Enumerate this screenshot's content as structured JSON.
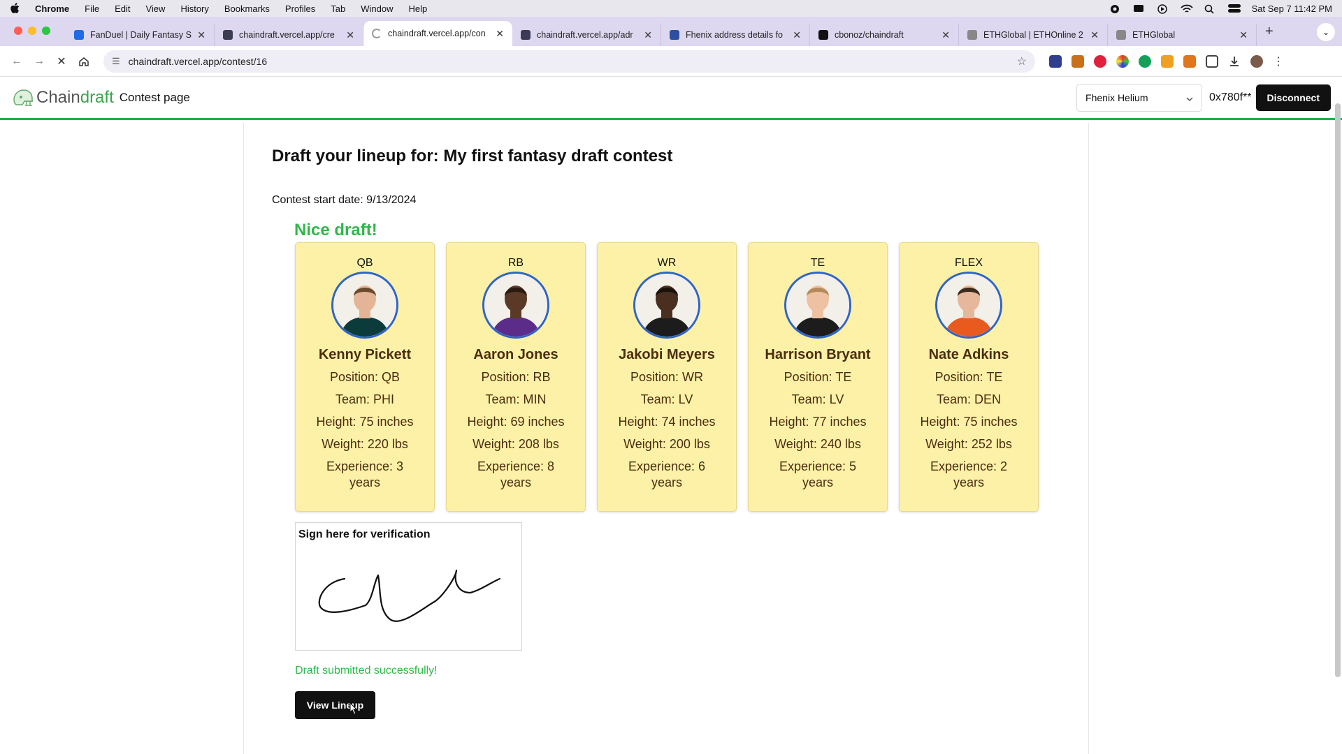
{
  "menubar": {
    "app": "Chrome",
    "items": [
      "File",
      "Edit",
      "View",
      "History",
      "Bookmarks",
      "Profiles",
      "Tab",
      "Window",
      "Help"
    ],
    "clock": "Sat Sep 7  11:42 PM"
  },
  "tabs": [
    {
      "title": "FanDuel | Daily Fantasy S",
      "color": "#1e6be8"
    },
    {
      "title": "chaindraft.vercel.app/cre",
      "color": "#3b3b54"
    },
    {
      "title": "chaindraft.vercel.app/con",
      "color": "#9a9a9a"
    },
    {
      "title": "chaindraft.vercel.app/adr",
      "color": "#3b3b54"
    },
    {
      "title": "Fhenix address details fo",
      "color": "#2d4fa0"
    },
    {
      "title": "cbonoz/chaindraft",
      "color": "#111111"
    },
    {
      "title": "ETHGlobal | ETHOnline 2",
      "color": "#888888"
    },
    {
      "title": "ETHGlobal",
      "color": "#888888"
    }
  ],
  "active_tab_index": 2,
  "omnibox": {
    "url": "chaindraft.vercel.app/contest/16"
  },
  "app": {
    "logo_chain": "Chain",
    "logo_draft": "draft",
    "page_label": "Contest page",
    "network": "Fhenix Helium",
    "address": "0x780f**",
    "disconnect_label": "Disconnect"
  },
  "contest": {
    "heading": "Draft your lineup for: My first fantasy draft contest",
    "start_date": "Contest start date: 9/13/2024",
    "nice_draft": "Nice draft!",
    "players": [
      {
        "slot": "QB",
        "name": "Kenny Pickett",
        "position": "Position: QB",
        "team": "Team: PHI",
        "height": "Height: 75 inches",
        "weight": "Weight: 220 lbs",
        "experience": "Experience: 3 years",
        "jersey": "#0c3b3b",
        "skin": "#e3b596",
        "hair": "#6b4a2e"
      },
      {
        "slot": "RB",
        "name": "Aaron Jones",
        "position": "Position: RB",
        "team": "Team: MIN",
        "height": "Height: 69 inches",
        "weight": "Weight: 208 lbs",
        "experience": "Experience: 8 years",
        "jersey": "#5b2c8a",
        "skin": "#5a3a26",
        "hair": "#2a1a10"
      },
      {
        "slot": "WR",
        "name": "Jakobi Meyers",
        "position": "Position: WR",
        "team": "Team: LV",
        "height": "Height: 74 inches",
        "weight": "Weight: 200 lbs",
        "experience": "Experience: 6 years",
        "jersey": "#1c1c1c",
        "skin": "#4a2f20",
        "hair": "#1b120b"
      },
      {
        "slot": "TE",
        "name": "Harrison Bryant",
        "position": "Position: TE",
        "team": "Team: LV",
        "height": "Height: 77 inches",
        "weight": "Weight: 240 lbs",
        "experience": "Experience: 5 years",
        "jersey": "#1c1c1c",
        "skin": "#eec1a3",
        "hair": "#b58a5a"
      },
      {
        "slot": "FLEX",
        "name": "Nate Adkins",
        "position": "Position: TE",
        "team": "Team: DEN",
        "height": "Height: 75 inches",
        "weight": "Weight: 252 lbs",
        "experience": "Experience: 2 years",
        "jersey": "#e85a1e",
        "skin": "#e6b79a",
        "hair": "#3b2a1d"
      }
    ],
    "sign_label": "Sign here for verification",
    "success_message": "Draft submitted successfully!",
    "view_lineup_label": "View Lineup"
  }
}
